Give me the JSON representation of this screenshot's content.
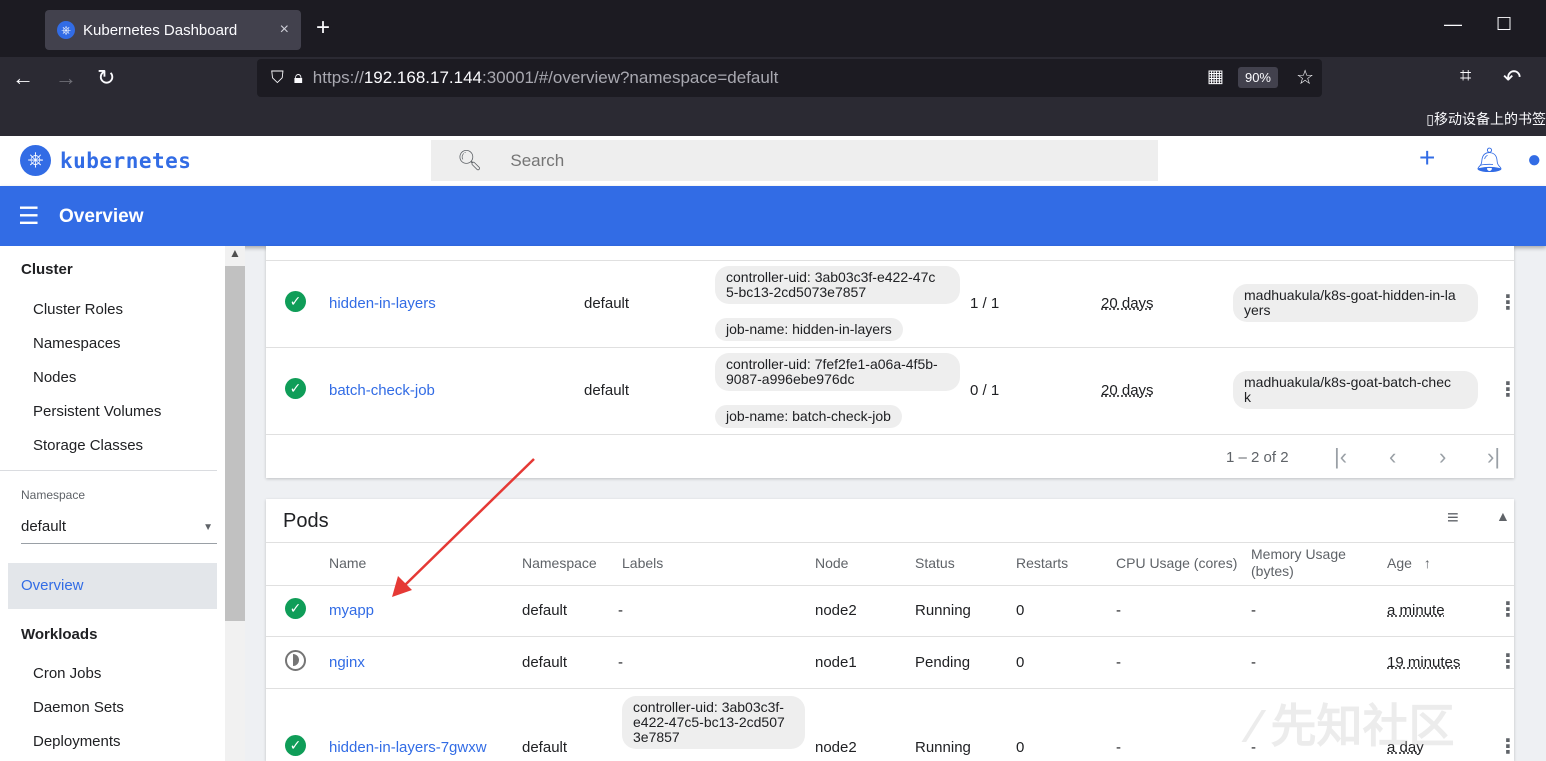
{
  "browser": {
    "tab_title": "Kubernetes Dashboard",
    "tab_close": "×",
    "new_tab": "+",
    "url_scheme": "https://",
    "url_host": "192.168.17.144",
    "url_rest": ":30001/#/overview?namespace=default",
    "zoom": "90%",
    "mobile_bookmarks": "移动设备上的书签"
  },
  "header": {
    "brand": "kubernetes",
    "search_placeholder": "Search"
  },
  "titlebar": {
    "title": "Overview"
  },
  "sidebar": {
    "cluster_heading": "Cluster",
    "cluster_items": [
      "Cluster Roles",
      "Namespaces",
      "Nodes",
      "Persistent Volumes",
      "Storage Classes"
    ],
    "namespace_label": "Namespace",
    "namespace_value": "default",
    "active_item": "Overview",
    "workloads_heading": "Workloads",
    "workload_items": [
      "Cron Jobs",
      "Daemon Sets",
      "Deployments"
    ]
  },
  "jobs": {
    "rows": [
      {
        "name": "hidden-in-layers",
        "namespace": "default",
        "label1": "controller-uid: 3ab03c3f-e422-47c5-bc13-2cd5073e7857",
        "label1_a": "controller-uid: 3ab03c3f-e422-47c",
        "label1_b": "5-bc13-2cd5073e7857",
        "label2": "job-name: hidden-in-layers",
        "pods": "1 / 1",
        "age": "20 days",
        "image_a": "madhuakula/k8s-goat-hidden-in-la",
        "image_b": "yers"
      },
      {
        "name": "batch-check-job",
        "namespace": "default",
        "label1_a": "controller-uid: 7fef2fe1-a06a-4f5b-",
        "label1_b": "9087-a996ebe976dc",
        "label2": "job-name: batch-check-job",
        "pods": "0 / 1",
        "age": "20 days",
        "image_a": "madhuakula/k8s-goat-batch-chec",
        "image_b": "k"
      }
    ],
    "pagination": "1 – 2 of 2"
  },
  "pods": {
    "title": "Pods",
    "columns": {
      "name": "Name",
      "namespace": "Namespace",
      "labels": "Labels",
      "node": "Node",
      "status": "Status",
      "restarts": "Restarts",
      "cpu": "CPU Usage (cores)",
      "memory_a": "Memory Usage",
      "memory_b": "(bytes)",
      "age": "Age"
    },
    "rows": [
      {
        "name": "myapp",
        "namespace": "default",
        "labels": "-",
        "node": "node2",
        "status": "Running",
        "restarts": "0",
        "cpu": "-",
        "memory": "-",
        "age": "a minute"
      },
      {
        "name": "nginx",
        "namespace": "default",
        "labels": "-",
        "node": "node1",
        "status": "Pending",
        "restarts": "0",
        "cpu": "-",
        "memory": "-",
        "age": "19 minutes"
      },
      {
        "name": "hidden-in-layers-7gwxw",
        "namespace": "default",
        "label_a": "controller-uid: 3ab03c3f-",
        "label_b": "e422-47c5-bc13-2cd507",
        "label_c": "3e7857",
        "node": "node2",
        "status": "Running",
        "restarts": "0",
        "cpu": "-",
        "memory": "-",
        "age": "a day"
      }
    ]
  },
  "colors": {
    "brand": "#326ce5",
    "ok": "#0f9d58",
    "arrow": "#e53935"
  },
  "watermark": "先知社区"
}
